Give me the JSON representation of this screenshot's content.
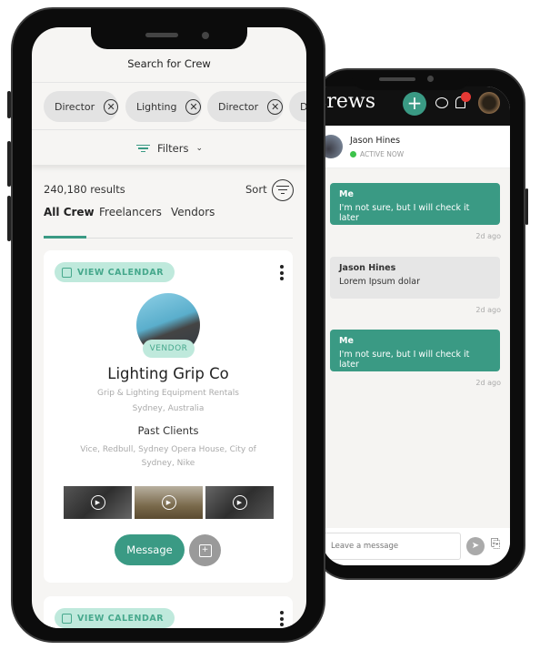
{
  "colors": {
    "brand": "#3a9a84",
    "brand_light": "#bfe9dc",
    "notification": "#e53935",
    "online": "#3cc24a"
  },
  "crew": {
    "title": "Search for Crew",
    "chips": [
      {
        "label": "Director"
      },
      {
        "label": "Lighting"
      },
      {
        "label": "Director"
      },
      {
        "label": "D"
      }
    ],
    "filters_label": "Filters",
    "results": "240,180 results",
    "sort_label": "Sort",
    "tabs": [
      {
        "label": "All Crew",
        "active": true
      },
      {
        "label": "Freelancers"
      },
      {
        "label": "Vendors"
      }
    ],
    "card": {
      "view_calendar": "VIEW CALENDAR",
      "badge": "VENDOR",
      "name": "Lighting Grip Co",
      "subtitle": "Grip & Lighting Equipment Rentals",
      "location": "Sydney, Australia",
      "past_clients_heading": "Past Clients",
      "past_clients": "Vice, Redbull, Sydney Opera House, City of Sydney, Nike",
      "message_label": "Message"
    },
    "card2": {
      "view_calendar": "VIEW CALENDAR"
    }
  },
  "chat": {
    "logo": "crews",
    "contact": {
      "name": "Jason Hines",
      "status": "ACTIVE NOW"
    },
    "messages": [
      {
        "sender": "Me",
        "text": "I'm not sure, but I will check it later",
        "time": "2d ago",
        "mine": true
      },
      {
        "sender": "Jason Hines",
        "text": "Lorem Ipsum dolar",
        "time": "2d ago",
        "mine": false
      },
      {
        "sender": "Me",
        "text": "I'm not sure, but I will check it later",
        "time": "2d ago",
        "mine": true
      }
    ],
    "input_placeholder": "Leave a message"
  }
}
